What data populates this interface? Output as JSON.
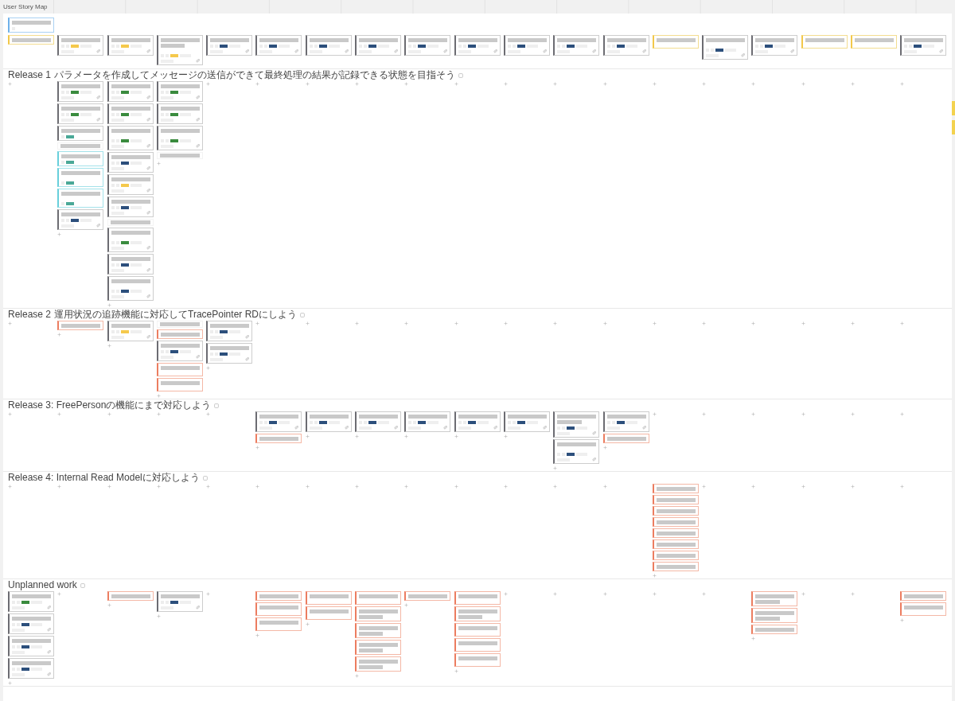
{
  "title": "User Story Map",
  "lanes": [
    {
      "kind": "backbone",
      "goal_card": {
        "kind": "goal",
        "second_line": false,
        "tall": false
      },
      "columns": [
        {
          "cards": [
            {
              "kind": "activity",
              "second_line": false,
              "tall": false
            }
          ]
        },
        {
          "cards": [
            {
              "kind": "story",
              "color": "#f5c94c",
              "second_line": false,
              "tall": false
            }
          ]
        },
        {
          "cards": [
            {
              "kind": "story",
              "color": "#f5c94c",
              "second_line": false,
              "tall": false
            }
          ]
        },
        {
          "cards": [
            {
              "kind": "story",
              "color": "#f5c94c",
              "second_line": true,
              "tall": true
            }
          ]
        },
        {
          "cards": [
            {
              "kind": "story",
              "color": "#2c4f7c",
              "second_line": false,
              "tall": false
            }
          ]
        },
        {
          "cards": [
            {
              "kind": "story",
              "color": "#2c4f7c",
              "second_line": false,
              "tall": false
            }
          ]
        },
        {
          "cards": [
            {
              "kind": "story",
              "color": "#2c4f7c",
              "second_line": false,
              "tall": false
            }
          ]
        },
        {
          "cards": [
            {
              "kind": "story",
              "color": "#2c4f7c",
              "second_line": false,
              "tall": false
            }
          ]
        },
        {
          "cards": [
            {
              "kind": "story",
              "color": "#2c4f7c",
              "second_line": false,
              "tall": false
            }
          ]
        },
        {
          "cards": [
            {
              "kind": "story",
              "color": "#2c4f7c",
              "second_line": false,
              "tall": false
            }
          ]
        },
        {
          "cards": [
            {
              "kind": "story",
              "color": "#2c4f7c",
              "second_line": false,
              "tall": false
            }
          ]
        },
        {
          "cards": [
            {
              "kind": "story",
              "color": "#2c4f7c",
              "second_line": false,
              "tall": false
            }
          ]
        },
        {
          "cards": [
            {
              "kind": "story",
              "color": "#2c4f7c",
              "second_line": false,
              "tall": false
            }
          ]
        },
        {
          "cards": [
            {
              "kind": "activity",
              "second_line": false,
              "tall": true
            }
          ]
        },
        {
          "cards": [
            {
              "kind": "story",
              "color": "#2c4f7c",
              "second_line": false,
              "tall": true
            }
          ]
        },
        {
          "cards": [
            {
              "kind": "story",
              "color": "#2c4f7c",
              "second_line": false,
              "tall": false
            }
          ]
        },
        {
          "cards": [
            {
              "kind": "activity",
              "second_line": false,
              "tall": true
            }
          ]
        },
        {
          "cards": [
            {
              "kind": "activity",
              "second_line": false,
              "tall": true
            }
          ]
        },
        {
          "cards": [
            {
              "kind": "story",
              "color": "#2c4f7c",
              "second_line": false,
              "tall": false
            }
          ]
        }
      ]
    },
    {
      "kind": "release",
      "label": "Release 1",
      "subtitle": "パラメータを作成してメッセージの送信ができて最終処理の結果が記録できる状態を目指そう",
      "columns": [
        {},
        {
          "cards": [
            {
              "kind": "story",
              "color": "#3a8b3e",
              "second_line": false,
              "tall": false
            },
            {
              "kind": "story",
              "color": "#3a8b3e",
              "second_line": false,
              "tall": false
            },
            {
              "kind": "task",
              "color": "#4aa897",
              "second_line": false,
              "tall": false
            },
            {
              "kind": "plain",
              "second_line": false,
              "tall": false
            },
            {
              "kind": "subtask",
              "color": "#4aa897",
              "second_line": false,
              "tall": false
            },
            {
              "kind": "subtask",
              "color": "#4aa897",
              "second_line": false,
              "tall": true
            },
            {
              "kind": "subtask",
              "color": "#4aa897",
              "second_line": false,
              "tall": true
            },
            {
              "kind": "story",
              "color": "#2c4f7c",
              "second_line": false,
              "tall": false
            }
          ]
        },
        {
          "cards": [
            {
              "kind": "story",
              "color": "#3a8b3e",
              "second_line": false,
              "tall": false
            },
            {
              "kind": "story",
              "color": "#3a8b3e",
              "second_line": false,
              "tall": false
            },
            {
              "kind": "story",
              "color": "#3a8b3e",
              "second_line": false,
              "tall": true
            },
            {
              "kind": "story",
              "color": "#2c4f7c",
              "second_line": false,
              "tall": false
            },
            {
              "kind": "story",
              "color": "#f5c94c",
              "second_line": false,
              "tall": false
            },
            {
              "kind": "story",
              "color": "#2c4f7c",
              "second_line": false,
              "tall": false
            },
            {
              "kind": "plain",
              "second_line": false,
              "tall": false
            },
            {
              "kind": "story",
              "color": "#3a8b3e",
              "second_line": false,
              "tall": true
            },
            {
              "kind": "story",
              "color": "#2c4f7c",
              "second_line": false,
              "tall": false
            },
            {
              "kind": "story",
              "color": "#2c4f7c",
              "second_line": false,
              "tall": true
            }
          ]
        },
        {
          "cards": [
            {
              "kind": "story",
              "color": "#3a8b3e",
              "second_line": false,
              "tall": false
            },
            {
              "kind": "story",
              "color": "#3a8b3e",
              "second_line": false,
              "tall": false
            },
            {
              "kind": "story",
              "color": "#3a8b3e",
              "second_line": false,
              "tall": true
            },
            {
              "kind": "plain",
              "second_line": false,
              "tall": false
            }
          ]
        },
        {},
        {},
        {},
        {},
        {},
        {},
        {},
        {},
        {},
        {},
        {},
        {},
        {},
        {},
        {}
      ]
    },
    {
      "kind": "release",
      "label": "Release 2",
      "subtitle": "運用状況の追跡機能に対応してTracePointer RDにしよう",
      "columns": [
        {},
        {
          "cards": [
            {
              "kind": "note",
              "second_line": false,
              "tall": false
            }
          ]
        },
        {
          "cards": [
            {
              "kind": "story",
              "color": "#f5c94c",
              "second_line": false,
              "tall": false
            }
          ]
        },
        {
          "cards": [
            {
              "kind": "plain",
              "second_line": false,
              "tall": false
            },
            {
              "kind": "note",
              "second_line": false,
              "tall": false
            },
            {
              "kind": "story",
              "color": "#2c4f7c",
              "second_line": false,
              "tall": false
            },
            {
              "kind": "note",
              "second_line": false,
              "tall": true
            },
            {
              "kind": "note",
              "second_line": false,
              "tall": true
            }
          ]
        },
        {
          "cards": [
            {
              "kind": "story",
              "color": "#2c4f7c",
              "second_line": false,
              "tall": false
            },
            {
              "kind": "story",
              "color": "#2c4f7c",
              "second_line": false,
              "tall": false
            }
          ]
        },
        {},
        {},
        {},
        {},
        {},
        {},
        {},
        {},
        {},
        {},
        {},
        {},
        {},
        {}
      ]
    },
    {
      "kind": "release",
      "label": "Release 3: FreePersonの機能にまで対応しよう",
      "columns": [
        {},
        {},
        {},
        {},
        {},
        {
          "cards": [
            {
              "kind": "story",
              "color": "#2c4f7c",
              "second_line": false,
              "tall": false
            },
            {
              "kind": "note",
              "second_line": false,
              "tall": false
            }
          ]
        },
        {
          "cards": [
            {
              "kind": "story",
              "color": "#2c4f7c",
              "second_line": false,
              "tall": false
            }
          ]
        },
        {
          "cards": [
            {
              "kind": "story",
              "color": "#2c4f7c",
              "second_line": false,
              "tall": false
            }
          ]
        },
        {
          "cards": [
            {
              "kind": "story",
              "color": "#2c4f7c",
              "second_line": false,
              "tall": false
            }
          ]
        },
        {
          "cards": [
            {
              "kind": "story",
              "color": "#2c4f7c",
              "second_line": false,
              "tall": false
            }
          ]
        },
        {
          "cards": [
            {
              "kind": "story",
              "color": "#2c4f7c",
              "second_line": false,
              "tall": false
            }
          ]
        },
        {
          "cards": [
            {
              "kind": "story",
              "color": "#2c4f7c",
              "second_line": true,
              "tall": false
            },
            {
              "kind": "story",
              "color": "#2c4f7c",
              "second_line": false,
              "tall": true
            }
          ]
        },
        {
          "cards": [
            {
              "kind": "story",
              "color": "#2c4f7c",
              "second_line": false,
              "tall": false
            },
            {
              "kind": "note",
              "second_line": false,
              "tall": false
            }
          ]
        },
        {},
        {},
        {},
        {},
        {},
        {}
      ]
    },
    {
      "kind": "release",
      "label": "Release 4: Internal Read Modelに対応しよう",
      "columns": [
        {},
        {},
        {},
        {},
        {},
        {},
        {},
        {},
        {},
        {},
        {},
        {},
        {},
        {
          "cards": [
            {
              "kind": "note",
              "second_line": false,
              "tall": false
            },
            {
              "kind": "note",
              "second_line": false,
              "tall": false
            },
            {
              "kind": "note",
              "second_line": false,
              "tall": false
            },
            {
              "kind": "note",
              "second_line": false,
              "tall": false
            },
            {
              "kind": "note",
              "second_line": false,
              "tall": false
            },
            {
              "kind": "note",
              "second_line": false,
              "tall": false
            },
            {
              "kind": "note",
              "second_line": false,
              "tall": false
            },
            {
              "kind": "note",
              "second_line": false,
              "tall": false
            }
          ]
        },
        {},
        {},
        {},
        {},
        {}
      ]
    },
    {
      "kind": "release",
      "label": "Unplanned work",
      "columns": [
        {
          "cards": [
            {
              "kind": "story",
              "color": "#3a8b3e",
              "second_line": false,
              "tall": false
            },
            {
              "kind": "story",
              "color": "#2c4f7c",
              "second_line": false,
              "tall": false
            },
            {
              "kind": "story",
              "color": "#2c4f7c",
              "second_line": false,
              "tall": false
            },
            {
              "kind": "story",
              "color": "#2c4f7c",
              "second_line": false,
              "tall": false
            }
          ]
        },
        {},
        {
          "cards": [
            {
              "kind": "note",
              "second_line": false,
              "tall": false
            }
          ]
        },
        {
          "cards": [
            {
              "kind": "story",
              "color": "#2c4f7c",
              "second_line": false,
              "tall": false
            }
          ]
        },
        {},
        {
          "cards": [
            {
              "kind": "note",
              "second_line": false,
              "tall": false
            },
            {
              "kind": "note",
              "second_line": false,
              "tall": true
            },
            {
              "kind": "note",
              "second_line": false,
              "tall": true
            }
          ]
        },
        {
          "cards": [
            {
              "kind": "note",
              "second_line": false,
              "tall": true
            },
            {
              "kind": "note",
              "second_line": false,
              "tall": true
            }
          ]
        },
        {
          "cards": [
            {
              "kind": "note",
              "second_line": false,
              "tall": true
            },
            {
              "kind": "note",
              "second_line": true,
              "tall": false
            },
            {
              "kind": "note",
              "second_line": true,
              "tall": false
            },
            {
              "kind": "note",
              "second_line": true,
              "tall": false
            },
            {
              "kind": "note",
              "second_line": true,
              "tall": false
            }
          ]
        },
        {
          "cards": [
            {
              "kind": "note",
              "second_line": false,
              "tall": false
            }
          ]
        },
        {
          "cards": [
            {
              "kind": "note",
              "second_line": false,
              "tall": true
            },
            {
              "kind": "note",
              "second_line": true,
              "tall": false
            },
            {
              "kind": "note",
              "second_line": false,
              "tall": true
            },
            {
              "kind": "note",
              "second_line": false,
              "tall": true
            },
            {
              "kind": "note",
              "second_line": false,
              "tall": true
            }
          ]
        },
        {},
        {},
        {},
        {},
        {},
        {
          "cards": [
            {
              "kind": "note",
              "second_line": true,
              "tall": false
            },
            {
              "kind": "note",
              "second_line": true,
              "tall": false
            },
            {
              "kind": "note",
              "second_line": false,
              "tall": false
            }
          ]
        },
        {},
        {},
        {
          "cards": [
            {
              "kind": "note",
              "second_line": false,
              "tall": false
            },
            {
              "kind": "note",
              "second_line": false,
              "tall": true
            }
          ]
        }
      ]
    }
  ],
  "edge_notes": [
    {
      "kind": "sticky"
    },
    {
      "kind": "sticky"
    }
  ]
}
